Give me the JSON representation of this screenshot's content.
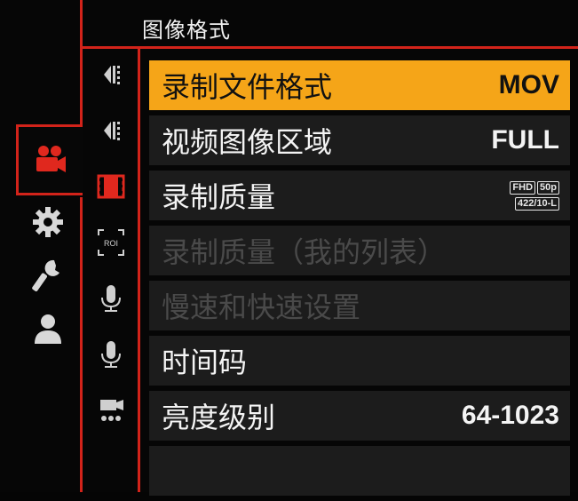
{
  "header": {
    "title": "图像格式"
  },
  "main_tabs": [
    {
      "icon": "video-camera-icon",
      "active": true
    },
    {
      "icon": "gear-icon",
      "active": false
    },
    {
      "icon": "wrench-icon",
      "active": false
    },
    {
      "icon": "user-icon",
      "active": false
    }
  ],
  "sub_tabs": [
    {
      "icon": "image-format-icon-1"
    },
    {
      "icon": "image-format-icon-2"
    },
    {
      "icon": "film-strip-icon"
    },
    {
      "icon": "roi-icon",
      "text": "ROI"
    },
    {
      "icon": "microphone-icon-1"
    },
    {
      "icon": "microphone-icon-2"
    },
    {
      "icon": "video-camera-dots-icon"
    }
  ],
  "menu": {
    "items": [
      {
        "label": "录制文件格式",
        "value": "MOV",
        "state": "selected"
      },
      {
        "label": "视频图像区域",
        "value": "FULL",
        "state": "normal"
      },
      {
        "label": "录制质量",
        "value": "",
        "state": "normal",
        "badge": {
          "row1": [
            "FHD",
            "50p"
          ],
          "row2": [
            "422/10-L"
          ]
        }
      },
      {
        "label": "录制质量（我的列表）",
        "value": "",
        "state": "disabled"
      },
      {
        "label": "慢速和快速设置",
        "value": "",
        "state": "disabled"
      },
      {
        "label": "时间码",
        "value": "",
        "state": "normal"
      },
      {
        "label": "亮度级别",
        "value": "64-1023",
        "state": "normal"
      }
    ]
  },
  "colors": {
    "accent_red": "#d2231a",
    "selected_bg": "#f5a518",
    "row_bg": "#1c1c1c",
    "disabled_text": "#4a4a4a"
  }
}
